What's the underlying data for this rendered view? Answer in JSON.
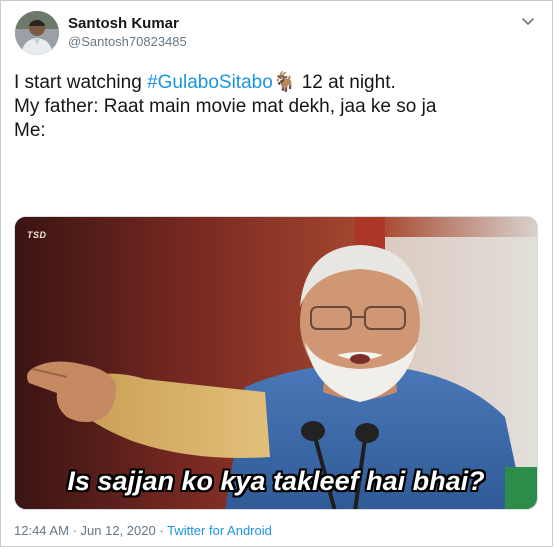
{
  "author": {
    "name": "Santosh Kumar",
    "handle": "@Santosh70823485"
  },
  "tweet": {
    "line1_prefix": "I start watching ",
    "hashtag": "#GulaboSitabo",
    "emoji": "🐐",
    "line1_suffix": " 12 at night.",
    "line2": "My father: Raat main movie mat dekh, jaa ke so ja",
    "line3": "Me:"
  },
  "media": {
    "watermark": "TSD",
    "caption": "Is sajjan ko kya takleef hai bhai?"
  },
  "meta": {
    "time": "12:44 AM",
    "date": "Jun 12, 2020",
    "separator": "·",
    "source": "Twitter for Android"
  },
  "colors": {
    "link": "#1b95e0",
    "text": "#14171a",
    "secondary": "#657786"
  },
  "icons": {
    "menu": "chevron-down-icon",
    "avatar": "user-avatar"
  }
}
